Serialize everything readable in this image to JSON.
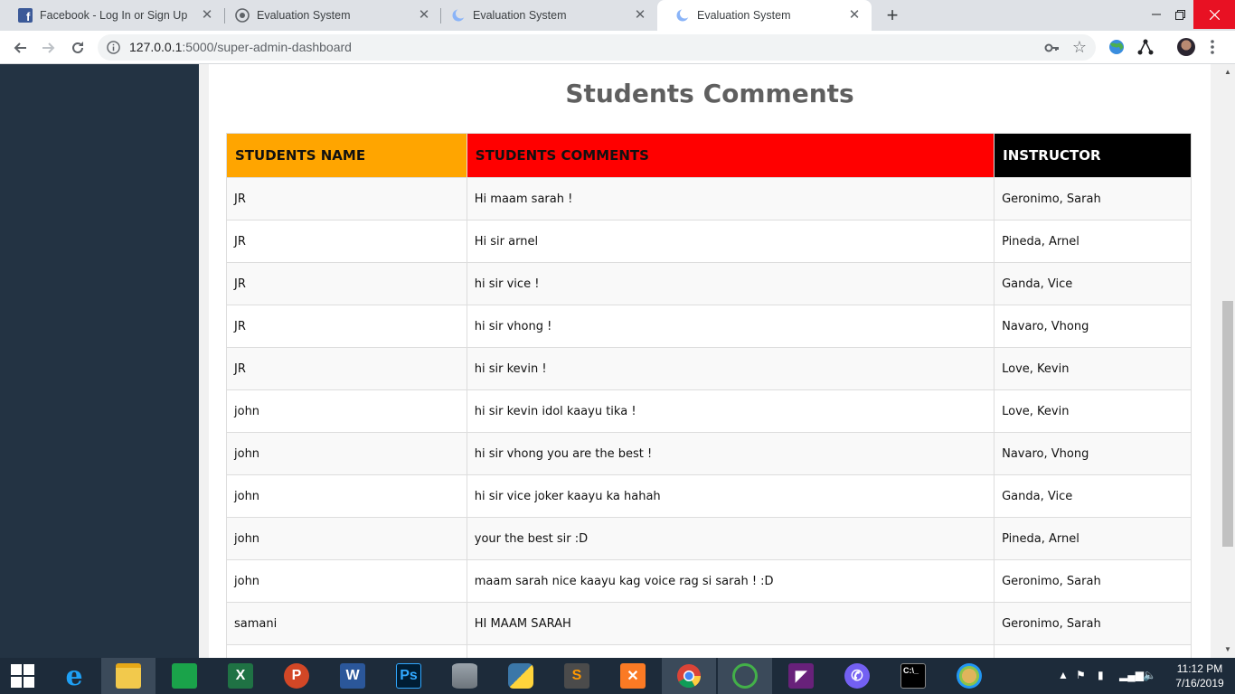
{
  "browser": {
    "tabs": [
      {
        "title": "Facebook - Log In or Sign Up",
        "favicon": "facebook-icon"
      },
      {
        "title": "Evaluation System",
        "favicon": "globe-icon"
      },
      {
        "title": "Evaluation System",
        "favicon": "crescent-icon"
      },
      {
        "title": "Evaluation System",
        "favicon": "crescent-icon",
        "active": true
      }
    ],
    "url_host": "127.0.0.1",
    "url_rest": ":5000/super-admin-dashboard"
  },
  "page": {
    "title": "Students Comments",
    "table": {
      "headers": [
        "STUDENTS NAME",
        "STUDENTS COMMENTS",
        "INSTRUCTOR"
      ],
      "header_colors": [
        "#ffa500",
        "#ff0000",
        "#000000"
      ],
      "rows": [
        [
          "JR",
          "Hi maam sarah !",
          "Geronimo, Sarah"
        ],
        [
          "JR",
          "Hi sir arnel",
          "Pineda, Arnel"
        ],
        [
          "JR",
          "hi sir vice !",
          "Ganda, Vice"
        ],
        [
          "JR",
          "hi sir vhong !",
          "Navaro, Vhong"
        ],
        [
          "JR",
          "hi sir kevin !",
          "Love, Kevin"
        ],
        [
          "john",
          "hi sir kevin idol kaayu tika !",
          "Love, Kevin"
        ],
        [
          "john",
          "hi sir vhong you are the best !",
          "Navaro, Vhong"
        ],
        [
          "john",
          "hi sir vice joker kaayu ka hahah",
          "Ganda, Vice"
        ],
        [
          "john",
          "your the best sir :D",
          "Pineda, Arnel"
        ],
        [
          "john",
          "maam sarah nice kaayu kag voice rag si sarah ! :D",
          "Geronimo, Sarah"
        ],
        [
          "samani",
          "HI MAAM SARAH",
          "Geronimo, Sarah"
        ],
        [
          "",
          "",
          ""
        ]
      ]
    }
  },
  "taskbar": {
    "apps": [
      "windows-start-icon",
      "internet-explorer-icon",
      "file-explorer-icon",
      "store-icon",
      "excel-icon",
      "powerpoint-icon",
      "word-icon",
      "photoshop-icon",
      "database-icon",
      "python-icon",
      "sublime-icon",
      "xampp-icon",
      "chrome-icon",
      "anaconda-icon",
      "visual-studio-icon",
      "viber-icon",
      "cmd-icon",
      "paint-icon"
    ],
    "time": "11:12 PM",
    "date": "7/16/2019"
  }
}
